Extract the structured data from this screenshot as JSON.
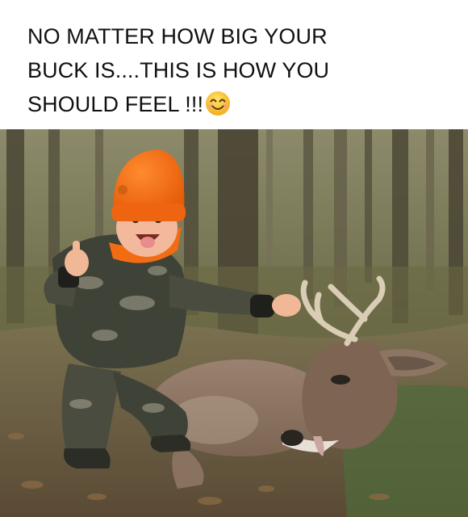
{
  "caption": {
    "line1": "NO MATTER HOW BIG YOUR",
    "line2": "BUCK IS....THIS IS HOW YOU",
    "line3": "SHOULD FEEL !!!",
    "emoji": "smiling-face-emoji"
  },
  "photo": {
    "subject": "photo-child-with-deer",
    "colors": {
      "hat": "#f36b12",
      "camo_dark": "#3f4237",
      "camo_light": "#a9a694",
      "deer": "#8c7563",
      "forest": "#6f6a52"
    }
  }
}
